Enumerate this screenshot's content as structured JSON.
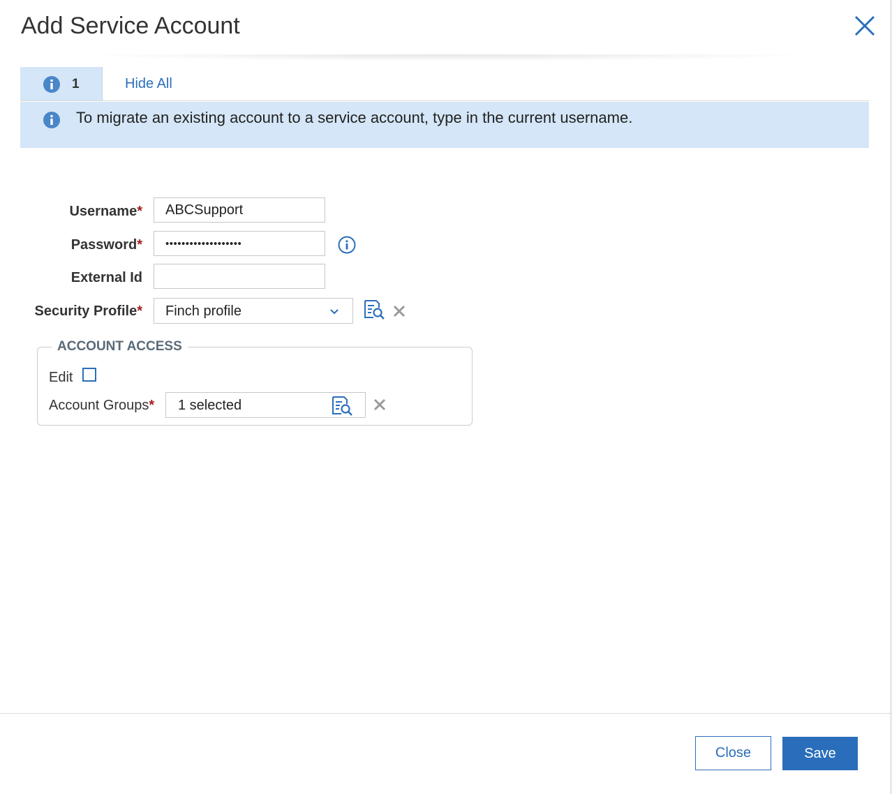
{
  "dialog": {
    "title": "Add Service Account"
  },
  "messages": {
    "count": "1",
    "hide_all_label": "Hide All",
    "banner_text": "To migrate an existing account to a service account, type in the current username."
  },
  "form": {
    "username": {
      "label": "Username",
      "required_mark": "*",
      "value": "ABCSupport"
    },
    "password": {
      "label": "Password",
      "required_mark": "*",
      "value": "•••••••••••••••••••"
    },
    "external_id": {
      "label": "External Id",
      "value": ""
    },
    "security_profile": {
      "label": "Security Profile",
      "required_mark": "*",
      "selected": "Finch profile"
    }
  },
  "account_access": {
    "legend": "ACCOUNT ACCESS",
    "edit_label": "Edit",
    "edit_checked": false,
    "account_groups": {
      "label": "Account Groups",
      "required_mark": "*",
      "value": "1 selected"
    }
  },
  "footer": {
    "close_label": "Close",
    "save_label": "Save"
  },
  "colors": {
    "accent": "#2a6ebb",
    "info_background": "#d4e6f7",
    "required": "#a41d1d"
  },
  "icons": {
    "close": "close-icon",
    "info": "info-icon",
    "info_outline": "info-outline-icon",
    "chevron": "chevron-down-icon",
    "lookup": "lookup-search-icon",
    "clear": "clear-icon"
  }
}
